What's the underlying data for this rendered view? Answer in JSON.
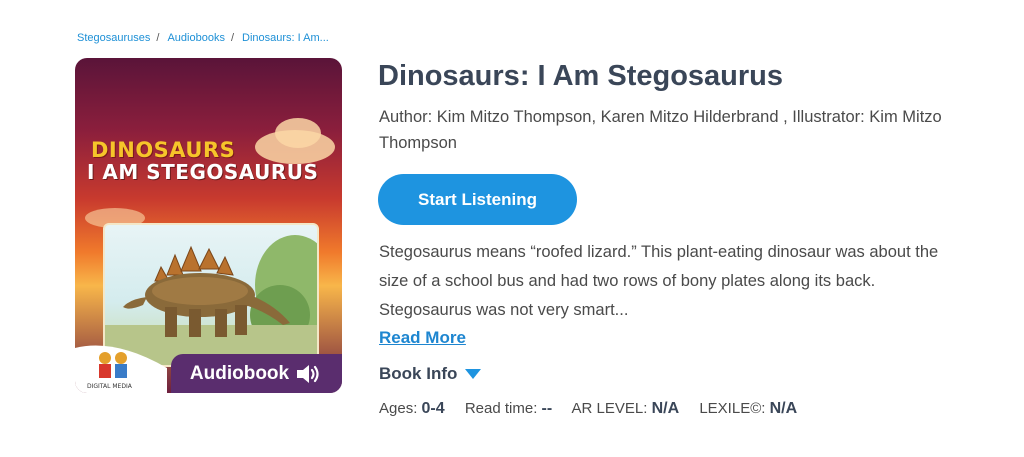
{
  "breadcrumb": {
    "items": [
      "Stegosauruses",
      "Audiobooks",
      "Dinosaurs: I Am..."
    ],
    "separator": "/"
  },
  "cover": {
    "title_line1": "DINOSAURS",
    "title_line2": "I AM STEGOSAURUS",
    "badge_label": "Audiobook",
    "badge_icon": "speaker-icon",
    "publisher_logo": "TWIN SISTERS",
    "publisher_sub": "DIGITAL MEDIA"
  },
  "book": {
    "title": "Dinosaurs: I Am Stegosaurus",
    "author_line": "Author: Kim Mitzo Thompson, Karen Mitzo Hilderbrand , Illustrator: Kim Mitzo Thompson",
    "listen_label": "Start Listening",
    "description": "Stegosaurus means “roofed lizard.” This plant-eating dinosaur was about the size of a school bus and had two rows of bony plates along its back. Stegosaurus was not very smart...",
    "read_more_label": "Read More",
    "book_info_label": "Book Info"
  },
  "meta": {
    "ages_label": "Ages:",
    "ages_value": "0-4",
    "read_time_label": "Read time:",
    "read_time_value": "--",
    "ar_label": "AR LEVEL:",
    "ar_value": "N/A",
    "lexile_label": "LEXILE©:",
    "lexile_value": "N/A"
  },
  "colors": {
    "accent": "#1e94e0",
    "link": "#1e86d0",
    "title": "#3a4658",
    "badge_bg": "#5a2d6e"
  }
}
